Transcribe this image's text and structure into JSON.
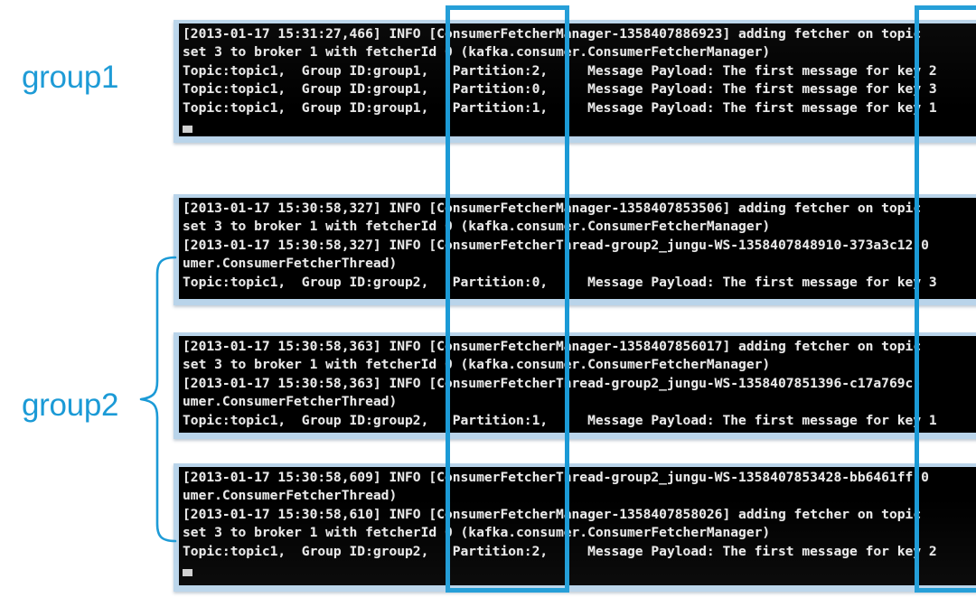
{
  "annotations": {
    "accent_color": "#1b9ad6",
    "group1_label": "group1",
    "group2_label": "group2",
    "brace_name": "group2-brace",
    "highlight_left_name": "partition-column-highlight",
    "highlight_right_name": "key-column-highlight"
  },
  "terminals": [
    {
      "group": "group1",
      "lines": [
        "[2013-01-17 15:31:27,466] INFO [ConsumerFetcherManager-1358407886923] adding fetcher on topic",
        "set 3 to broker 1 with fetcherId 0 (kafka.consumer.ConsumerFetcherManager)",
        "Topic:topic1,  Group ID:group1,   Partition:2,     Message Payload: The first message for key 2",
        "Topic:topic1,  Group ID:group1,   Partition:0,     Message Payload: The first message for key 3",
        "Topic:topic1,  Group ID:group1,   Partition:1,     Message Payload: The first message for key 1"
      ],
      "cursor": true
    },
    {
      "group": "group2",
      "lines": [
        "[2013-01-17 15:30:58,327] INFO [ConsumerFetcherManager-1358407853506] adding fetcher on topic",
        "set 3 to broker 1 with fetcherId 0 (kafka.consumer.ConsumerFetcherManager)",
        "[2013-01-17 15:30:58,327] INFO [ConsumerFetcherThread-group2_jungu-WS-1358407848910-373a3c12-0",
        "umer.ConsumerFetcherThread)",
        "Topic:topic1,  Group ID:group2,   Partition:0,     Message Payload: The first message for key 3"
      ],
      "cursor": true
    },
    {
      "group": "group2",
      "lines": [
        "[2013-01-17 15:30:58,363] INFO [ConsumerFetcherManager-1358407856017] adding fetcher on topic",
        "set 3 to broker 1 with fetcherId 0 (kafka.consumer.ConsumerFetcherManager)",
        "[2013-01-17 15:30:58,363] INFO [ConsumerFetcherThread-group2_jungu-WS-1358407851396-c17a769c-",
        "umer.ConsumerFetcherThread)",
        "Topic:topic1,  Group ID:group2,   Partition:1,     Message Payload: The first message for key 1"
      ],
      "cursor": false
    },
    {
      "group": "group2",
      "lines": [
        "[2013-01-17 15:30:58,609] INFO [ConsumerFetcherThread-group2_jungu-WS-1358407853428-bb6461ff-0",
        "umer.ConsumerFetcherThread)",
        "[2013-01-17 15:30:58,610] INFO [ConsumerFetcherManager-1358407858026] adding fetcher on topic",
        "set 3 to broker 1 with fetcherId 0 (kafka.consumer.ConsumerFetcherManager)",
        "Topic:topic1,  Group ID:group2,   Partition:2,     Message Payload: The first message for key 2"
      ],
      "cursor": true
    }
  ]
}
